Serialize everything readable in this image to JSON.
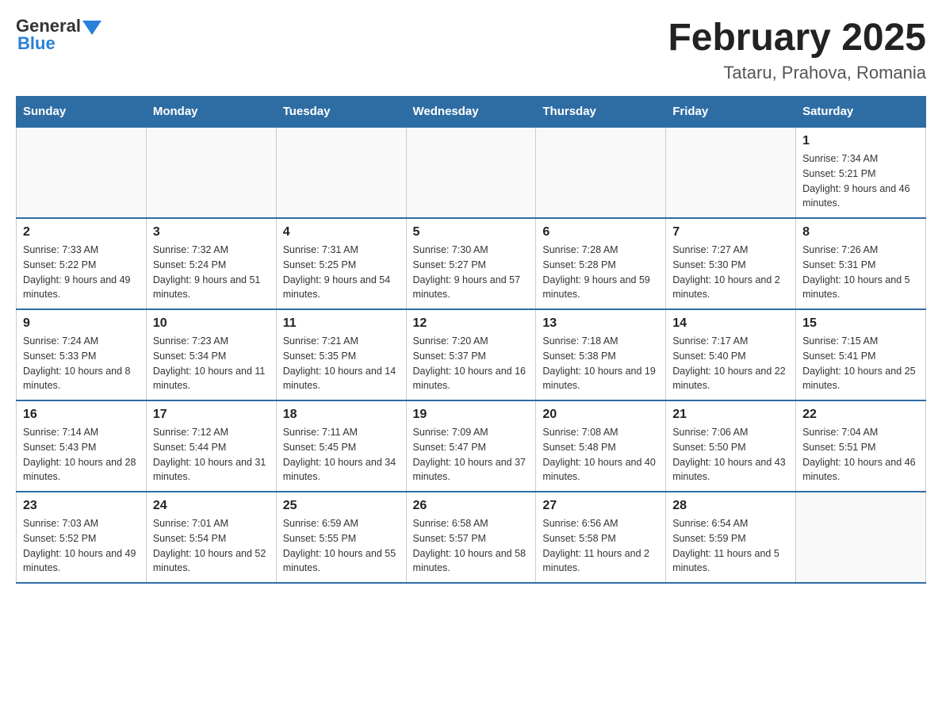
{
  "logo": {
    "text_general": "General",
    "text_blue": "Blue"
  },
  "title": "February 2025",
  "subtitle": "Tataru, Prahova, Romania",
  "days_of_week": [
    "Sunday",
    "Monday",
    "Tuesday",
    "Wednesday",
    "Thursday",
    "Friday",
    "Saturday"
  ],
  "weeks": [
    [
      {
        "day": "",
        "info": ""
      },
      {
        "day": "",
        "info": ""
      },
      {
        "day": "",
        "info": ""
      },
      {
        "day": "",
        "info": ""
      },
      {
        "day": "",
        "info": ""
      },
      {
        "day": "",
        "info": ""
      },
      {
        "day": "1",
        "info": "Sunrise: 7:34 AM\nSunset: 5:21 PM\nDaylight: 9 hours and 46 minutes."
      }
    ],
    [
      {
        "day": "2",
        "info": "Sunrise: 7:33 AM\nSunset: 5:22 PM\nDaylight: 9 hours and 49 minutes."
      },
      {
        "day": "3",
        "info": "Sunrise: 7:32 AM\nSunset: 5:24 PM\nDaylight: 9 hours and 51 minutes."
      },
      {
        "day": "4",
        "info": "Sunrise: 7:31 AM\nSunset: 5:25 PM\nDaylight: 9 hours and 54 minutes."
      },
      {
        "day": "5",
        "info": "Sunrise: 7:30 AM\nSunset: 5:27 PM\nDaylight: 9 hours and 57 minutes."
      },
      {
        "day": "6",
        "info": "Sunrise: 7:28 AM\nSunset: 5:28 PM\nDaylight: 9 hours and 59 minutes."
      },
      {
        "day": "7",
        "info": "Sunrise: 7:27 AM\nSunset: 5:30 PM\nDaylight: 10 hours and 2 minutes."
      },
      {
        "day": "8",
        "info": "Sunrise: 7:26 AM\nSunset: 5:31 PM\nDaylight: 10 hours and 5 minutes."
      }
    ],
    [
      {
        "day": "9",
        "info": "Sunrise: 7:24 AM\nSunset: 5:33 PM\nDaylight: 10 hours and 8 minutes."
      },
      {
        "day": "10",
        "info": "Sunrise: 7:23 AM\nSunset: 5:34 PM\nDaylight: 10 hours and 11 minutes."
      },
      {
        "day": "11",
        "info": "Sunrise: 7:21 AM\nSunset: 5:35 PM\nDaylight: 10 hours and 14 minutes."
      },
      {
        "day": "12",
        "info": "Sunrise: 7:20 AM\nSunset: 5:37 PM\nDaylight: 10 hours and 16 minutes."
      },
      {
        "day": "13",
        "info": "Sunrise: 7:18 AM\nSunset: 5:38 PM\nDaylight: 10 hours and 19 minutes."
      },
      {
        "day": "14",
        "info": "Sunrise: 7:17 AM\nSunset: 5:40 PM\nDaylight: 10 hours and 22 minutes."
      },
      {
        "day": "15",
        "info": "Sunrise: 7:15 AM\nSunset: 5:41 PM\nDaylight: 10 hours and 25 minutes."
      }
    ],
    [
      {
        "day": "16",
        "info": "Sunrise: 7:14 AM\nSunset: 5:43 PM\nDaylight: 10 hours and 28 minutes."
      },
      {
        "day": "17",
        "info": "Sunrise: 7:12 AM\nSunset: 5:44 PM\nDaylight: 10 hours and 31 minutes."
      },
      {
        "day": "18",
        "info": "Sunrise: 7:11 AM\nSunset: 5:45 PM\nDaylight: 10 hours and 34 minutes."
      },
      {
        "day": "19",
        "info": "Sunrise: 7:09 AM\nSunset: 5:47 PM\nDaylight: 10 hours and 37 minutes."
      },
      {
        "day": "20",
        "info": "Sunrise: 7:08 AM\nSunset: 5:48 PM\nDaylight: 10 hours and 40 minutes."
      },
      {
        "day": "21",
        "info": "Sunrise: 7:06 AM\nSunset: 5:50 PM\nDaylight: 10 hours and 43 minutes."
      },
      {
        "day": "22",
        "info": "Sunrise: 7:04 AM\nSunset: 5:51 PM\nDaylight: 10 hours and 46 minutes."
      }
    ],
    [
      {
        "day": "23",
        "info": "Sunrise: 7:03 AM\nSunset: 5:52 PM\nDaylight: 10 hours and 49 minutes."
      },
      {
        "day": "24",
        "info": "Sunrise: 7:01 AM\nSunset: 5:54 PM\nDaylight: 10 hours and 52 minutes."
      },
      {
        "day": "25",
        "info": "Sunrise: 6:59 AM\nSunset: 5:55 PM\nDaylight: 10 hours and 55 minutes."
      },
      {
        "day": "26",
        "info": "Sunrise: 6:58 AM\nSunset: 5:57 PM\nDaylight: 10 hours and 58 minutes."
      },
      {
        "day": "27",
        "info": "Sunrise: 6:56 AM\nSunset: 5:58 PM\nDaylight: 11 hours and 2 minutes."
      },
      {
        "day": "28",
        "info": "Sunrise: 6:54 AM\nSunset: 5:59 PM\nDaylight: 11 hours and 5 minutes."
      },
      {
        "day": "",
        "info": ""
      }
    ]
  ]
}
